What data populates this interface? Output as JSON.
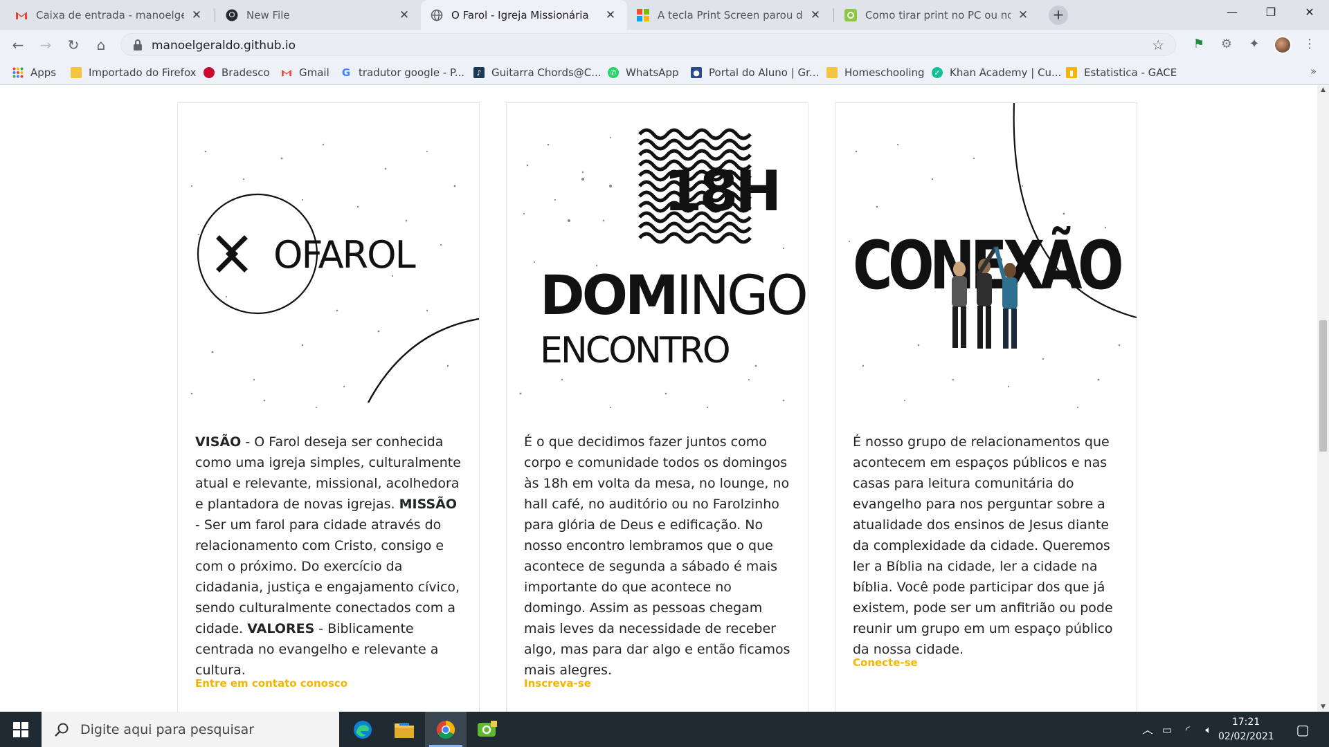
{
  "tabs": [
    {
      "title": "Caixa de entrada - manoelgeraldo",
      "icon": "gmail-icon"
    },
    {
      "title": "New File",
      "icon": "github-icon"
    },
    {
      "title": "O Farol - Igreja Missionária",
      "icon": "globe-icon"
    },
    {
      "title": "A tecla Print Screen parou de fun",
      "icon": "microsoft-icon"
    },
    {
      "title": "Como tirar print no PC ou notebook",
      "icon": "techtudo-icon"
    }
  ],
  "omnibox": {
    "url": "manoelgeraldo.github.io"
  },
  "bookmarks": [
    {
      "label": "Apps",
      "icon": "apps-grid-icon"
    },
    {
      "label": "Importado do Firefox",
      "icon": "folder-icon"
    },
    {
      "label": "Bradesco",
      "icon": "bradesco-icon"
    },
    {
      "label": "Gmail",
      "icon": "gmail-icon"
    },
    {
      "label": "tradutor google - P...",
      "icon": "google-icon"
    },
    {
      "label": "Guitarra Chords@C...",
      "icon": "guitar-icon"
    },
    {
      "label": "WhatsApp",
      "icon": "whatsapp-icon"
    },
    {
      "label": "Portal do Aluno | Gr...",
      "icon": "portal-icon"
    },
    {
      "label": "Homeschooling",
      "icon": "folder-icon"
    },
    {
      "label": "Khan Academy | Cu...",
      "icon": "khan-icon"
    },
    {
      "label": "Estatistica - GACE",
      "icon": "chart-icon"
    }
  ],
  "cards": [
    {
      "art": {
        "logo_text": "OFAROL"
      },
      "segments": [
        {
          "b": true,
          "t": "VISÃO"
        },
        {
          "b": false,
          "t": " - O Farol deseja ser conhecida como uma igreja simples, culturalmente atual e relevante, missional, acolhedora e plantadora de novas igrejas. "
        },
        {
          "b": true,
          "t": "MISSÃO"
        },
        {
          "b": false,
          "t": " - Ser um farol para cidade através do relacionamento com Cristo, consigo e com o próximo. Do exercício da cidadania, justiça e engajamento cívico, sendo culturalmente conectados com a cidade. "
        },
        {
          "b": true,
          "t": "VALORES"
        },
        {
          "b": false,
          "t": " - Biblicamente centrada no evangelho e relevante a cultura."
        }
      ],
      "cta": "Entre em contato conosco"
    },
    {
      "art": {
        "time": "18H",
        "dom_bold": "DOM",
        "dom_light": "INGO.",
        "sub": "ENCONTRO"
      },
      "segments": [
        {
          "b": false,
          "t": "É o que decidimos fazer juntos como corpo e comunidade todos os domingos às 18h em volta da mesa, no lounge, no hall café, no auditório ou no Farolzinho para glória de Deus e edificação. No nosso encontro lembramos que o que acontece de segunda a sábado é mais importante do que acontece no domingo. Assim as pessoas chegam mais leves da necessidade de receber algo, mas para dar algo e então ficamos mais alegres."
        }
      ],
      "cta": "Inscreva-se"
    },
    {
      "art": {
        "word": "CONEXÃO"
      },
      "segments": [
        {
          "b": false,
          "t": "É nosso grupo de relacionamentos que acontecem em espaços públicos e nas casas para leitura comunitária do evangelho para nos perguntar sobre a atualidade dos ensinos de Jesus diante da complexidade da cidade. Queremos ler a Bíblia na cidade, ler a cidade na bíblia. Você pode participar dos que já existem, pode ser um anfitrião ou pode reunir um grupo em um espaço público da nossa cidade."
        }
      ],
      "cta": "Conecte-se"
    }
  ],
  "taskbar": {
    "search_placeholder": "Digite aqui para pesquisar",
    "time": "17:21",
    "date": "02/02/2021",
    "accent": "#8ab4f8"
  },
  "colors": {
    "cta": "#f5b400",
    "tab_bar": "#dfe3ea",
    "taskbar": "#1f2a33"
  }
}
